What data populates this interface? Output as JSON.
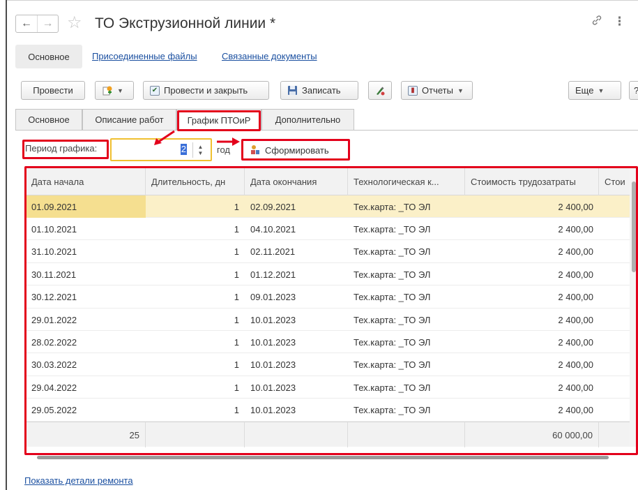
{
  "window": {
    "title": "ТО Экструзионной линии *",
    "back_icon": "←",
    "forward_icon": "→",
    "star_icon": "☆",
    "link_icon": "🔗",
    "more_icon": "⋮"
  },
  "section_nav": {
    "active": "Основное",
    "links": [
      "Присоединенные файлы",
      "Связанные документы"
    ]
  },
  "toolbar": {
    "post_label": "Провести",
    "post_close_label": "Провести и закрыть",
    "write_label": "Записать",
    "reports_label": "Отчеты",
    "more_label": "Еще",
    "help_label": "?"
  },
  "tabs": [
    "Основное",
    "Описание работ",
    "График ПТОиР",
    "Дополнительно"
  ],
  "period": {
    "label": "Период графика:",
    "value": "2",
    "unit": "год",
    "generate_label": "Сформировать"
  },
  "table": {
    "columns": [
      "Дата начала",
      "Длительность, дн",
      "Дата окончания",
      "Технологическая к...",
      "Стоимость трудозатраты",
      "Стои"
    ],
    "rows": [
      {
        "start": "01.09.2021",
        "duration": "1",
        "end": "02.09.2021",
        "tech": "Тех.карта: _ТО ЭЛ",
        "cost": "2 400,00"
      },
      {
        "start": "01.10.2021",
        "duration": "1",
        "end": "04.10.2021",
        "tech": "Тех.карта: _ТО ЭЛ",
        "cost": "2 400,00"
      },
      {
        "start": "31.10.2021",
        "duration": "1",
        "end": "02.11.2021",
        "tech": "Тех.карта: _ТО ЭЛ",
        "cost": "2 400,00"
      },
      {
        "start": "30.11.2021",
        "duration": "1",
        "end": "01.12.2021",
        "tech": "Тех.карта: _ТО ЭЛ",
        "cost": "2 400,00"
      },
      {
        "start": "30.12.2021",
        "duration": "1",
        "end": "09.01.2023",
        "tech": "Тех.карта: _ТО ЭЛ",
        "cost": "2 400,00"
      },
      {
        "start": "29.01.2022",
        "duration": "1",
        "end": "10.01.2023",
        "tech": "Тех.карта: _ТО ЭЛ",
        "cost": "2 400,00"
      },
      {
        "start": "28.02.2022",
        "duration": "1",
        "end": "10.01.2023",
        "tech": "Тех.карта: _ТО ЭЛ",
        "cost": "2 400,00"
      },
      {
        "start": "30.03.2022",
        "duration": "1",
        "end": "10.01.2023",
        "tech": "Тех.карта: _ТО ЭЛ",
        "cost": "2 400,00"
      },
      {
        "start": "29.04.2022",
        "duration": "1",
        "end": "10.01.2023",
        "tech": "Тех.карта: _ТО ЭЛ",
        "cost": "2 400,00"
      },
      {
        "start": "29.05.2022",
        "duration": "1",
        "end": "10.01.2023",
        "tech": "Тех.карта: _ТО ЭЛ",
        "cost": "2 400,00"
      }
    ],
    "footer": {
      "count": "25",
      "total_cost": "60 000,00"
    }
  },
  "details_link": "Показать детали ремонта",
  "colors": {
    "annotation": "#e3001b",
    "input_focus": "#f0c030",
    "selected_row": "#fbf0c8",
    "link": "#1a4fa0"
  }
}
